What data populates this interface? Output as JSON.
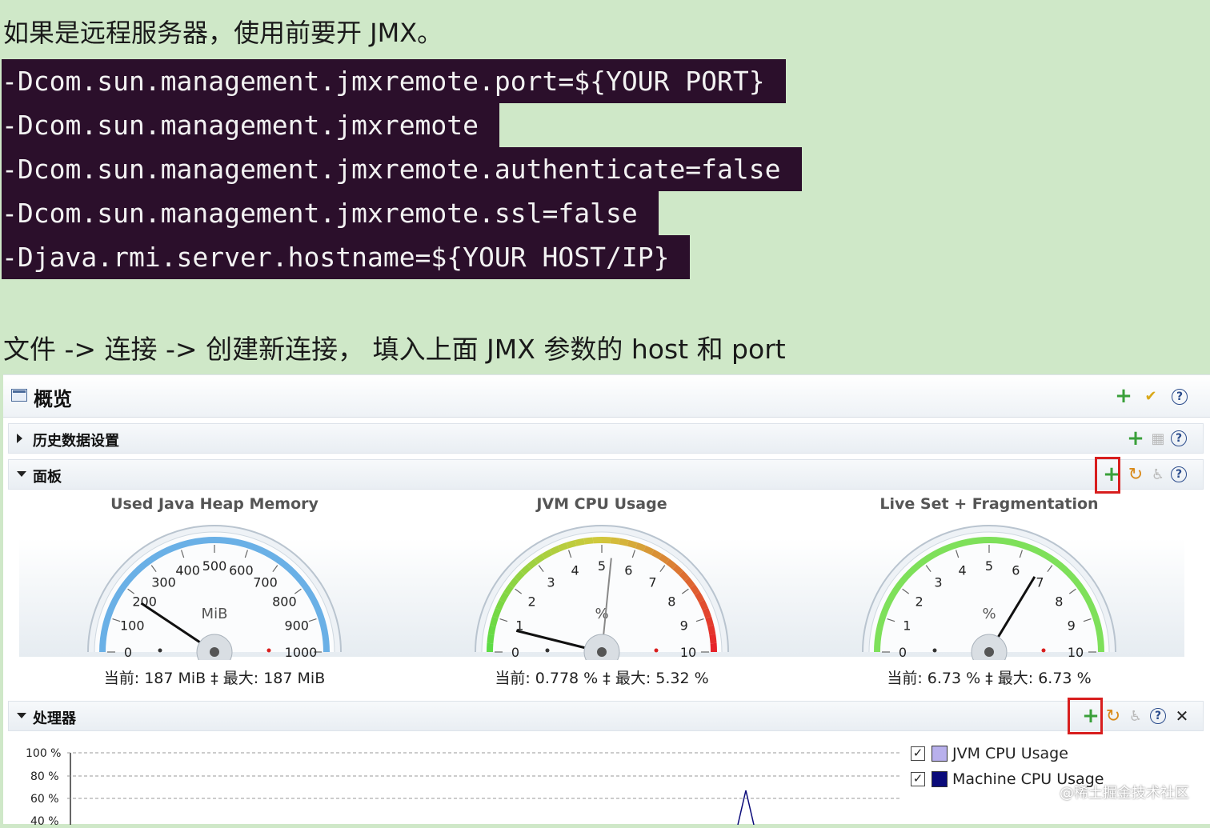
{
  "intro": {
    "line1": "如果是远程服务器，使用前要开 JMX。",
    "code_lines": [
      "-Dcom.sun.management.jmxremote.port=${YOUR PORT}",
      "-Dcom.sun.management.jmxremote",
      "-Dcom.sun.management.jmxremote.authenticate=false",
      "-Dcom.sun.management.jmxremote.ssl=false",
      "-Djava.rmi.server.hostname=${YOUR HOST/IP}"
    ],
    "line2": "文件 -> 连接 -> 创建新连接， 填入上面 JMX 参数的 host 和 port"
  },
  "window": {
    "title": "概览"
  },
  "sections": {
    "history": {
      "label": "历史数据设置"
    },
    "dashboard": {
      "label": "面板"
    },
    "processor": {
      "label": "处理器"
    }
  },
  "gauges": [
    {
      "title": "Used Java Heap Memory",
      "unit": "MiB",
      "ticks": [
        "0",
        "100",
        "200",
        "300",
        "400",
        "500",
        "600",
        "700",
        "800",
        "900",
        "1000"
      ],
      "min": 0,
      "max": 1000,
      "value": 187,
      "readout": "当前: 187 MiB ‡ 最大: 187 MiB",
      "color": "#6ab0e6"
    },
    {
      "title": "JVM CPU Usage",
      "unit": "%",
      "ticks": [
        "0",
        "1",
        "2",
        "3",
        "4",
        "5",
        "6",
        "7",
        "8",
        "9",
        "10"
      ],
      "min": 0,
      "max": 10,
      "value": 0.778,
      "peak": 5.32,
      "readout": "当前: 0.778 % ‡ 最大: 5.32 %",
      "color": "gradient"
    },
    {
      "title": "Live Set + Fragmentation",
      "unit": "%",
      "ticks": [
        "0",
        "1",
        "2",
        "3",
        "4",
        "5",
        "6",
        "7",
        "8",
        "9",
        "10"
      ],
      "min": 0,
      "max": 10,
      "value": 6.73,
      "readout": "当前: 6.73 % ‡ 最大: 6.73 %",
      "color": "#7ee05a"
    }
  ],
  "processor_chart": {
    "y_ticks": [
      "100 %",
      "80 %",
      "60 %",
      "40 %"
    ],
    "legend": [
      {
        "name": "JVM CPU Usage",
        "checked": true,
        "color": "#b8b0ec"
      },
      {
        "name": "Machine CPU Usage",
        "checked": true,
        "color": "#0b0b7a"
      }
    ]
  },
  "watermark": "@稀土掘金技术社区"
}
